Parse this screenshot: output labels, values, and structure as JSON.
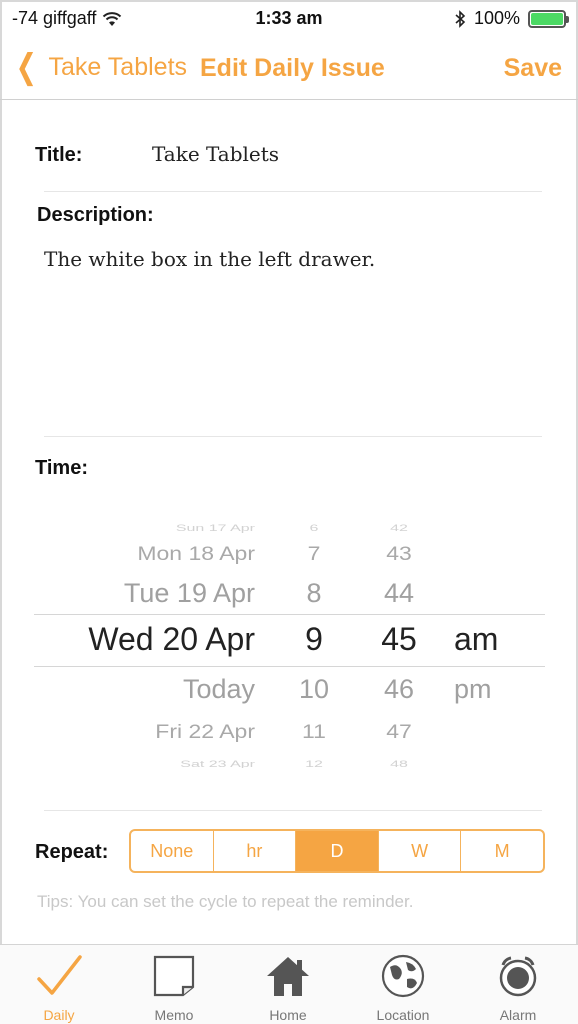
{
  "status_bar": {
    "carrier": "-74 giffgaff",
    "time": "1:33 am",
    "battery": "100%",
    "battery_level": 1.0
  },
  "nav": {
    "back_label": "Take Tablets",
    "title": "Edit Daily Issue",
    "save_label": "Save"
  },
  "form": {
    "title_label": "Title:",
    "title_value": "Take Tablets",
    "description_label": "Description:",
    "description_value": "The white box in the left drawer.",
    "time_label": "Time:",
    "repeat_label": "Repeat:",
    "tips": "Tips: You can set the cycle to repeat the reminder."
  },
  "picker": {
    "rows": [
      {
        "date": "Sun 17 Apr",
        "hour": "6",
        "minute": "42",
        "ampm": ""
      },
      {
        "date": "Mon 18 Apr",
        "hour": "7",
        "minute": "43",
        "ampm": ""
      },
      {
        "date": "Tue 19 Apr",
        "hour": "8",
        "minute": "44",
        "ampm": ""
      },
      {
        "date": "Wed 20 Apr",
        "hour": "9",
        "minute": "45",
        "ampm": "am"
      },
      {
        "date": "Today",
        "hour": "10",
        "minute": "46",
        "ampm": "pm"
      },
      {
        "date": "Fri 22 Apr",
        "hour": "11",
        "minute": "47",
        "ampm": ""
      },
      {
        "date": "Sat 23 Apr",
        "hour": "12",
        "minute": "48",
        "ampm": ""
      }
    ],
    "selected_index": 3
  },
  "repeat": {
    "options": [
      "None",
      "hr",
      "D",
      "W",
      "M"
    ],
    "selected": "D"
  },
  "tabbar": {
    "items": [
      {
        "label": "Daily",
        "icon": "checkmark-icon",
        "active": true
      },
      {
        "label": "Memo",
        "icon": "memo-icon",
        "active": false
      },
      {
        "label": "Home",
        "icon": "home-icon",
        "active": false
      },
      {
        "label": "Location",
        "icon": "globe-icon",
        "active": false
      },
      {
        "label": "Alarm",
        "icon": "alarm-icon",
        "active": false
      }
    ]
  },
  "colors": {
    "accent": "#f5a543",
    "tips": "#c8c8c8",
    "battery": "#4cd964"
  }
}
